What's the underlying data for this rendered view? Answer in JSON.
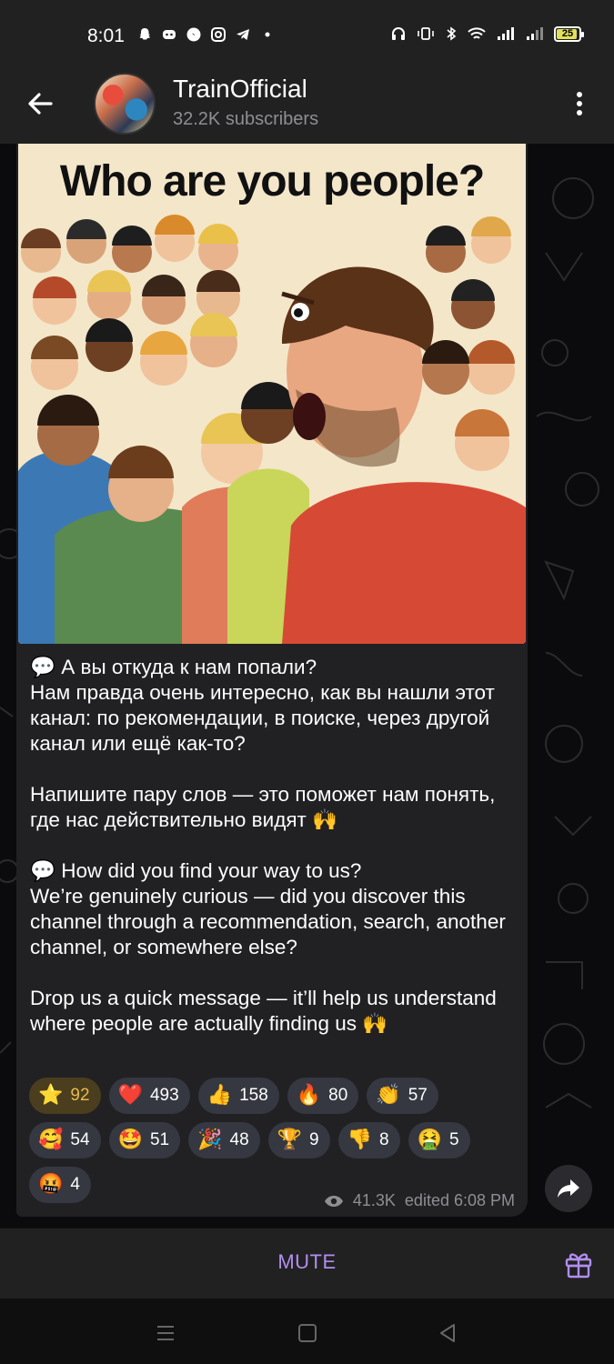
{
  "status_bar": {
    "time": "8:01",
    "battery": "25"
  },
  "header": {
    "title": "TrainOfficial",
    "subtitle": "32.2K subscribers"
  },
  "post": {
    "image_title": "Who are you people?",
    "text": "💬 А вы откуда к нам попали?\nНам правда очень интересно, как вы нашли этот канал: по рекомендации, в поиске, через другой канал или ещё как-то?\n\nНапишите пару слов — это поможет нам понять, где нас действительно видят 🙌\n\n💬 How did you find your way to us?\nWe’re genuinely curious — did you discover this channel through a recommendation, search, another channel, or somewhere else?\n\nDrop us a quick message — it’ll help us understand where people are actually finding us 🙌",
    "reactions": [
      {
        "emoji": "⭐",
        "count": "92",
        "active": true
      },
      {
        "emoji": "❤️",
        "count": "493"
      },
      {
        "emoji": "👍",
        "count": "158"
      },
      {
        "emoji": "🔥",
        "count": "80"
      },
      {
        "emoji": "👏",
        "count": "57"
      },
      {
        "emoji": "🥰",
        "count": "54"
      },
      {
        "emoji": "🤩",
        "count": "51"
      },
      {
        "emoji": "🎉",
        "count": "48"
      },
      {
        "emoji": "🏆",
        "count": "9"
      },
      {
        "emoji": "👎",
        "count": "8"
      },
      {
        "emoji": "🤮",
        "count": "5"
      },
      {
        "emoji": "🤬",
        "count": "4"
      }
    ],
    "views": "41.3K",
    "edited": "edited 6:08 PM"
  },
  "bottom_bar": {
    "mute_label": "MUTE"
  },
  "colors": {
    "accent": "#b08ef0",
    "bubble": "#212124",
    "star_active": "#e8b94a"
  }
}
